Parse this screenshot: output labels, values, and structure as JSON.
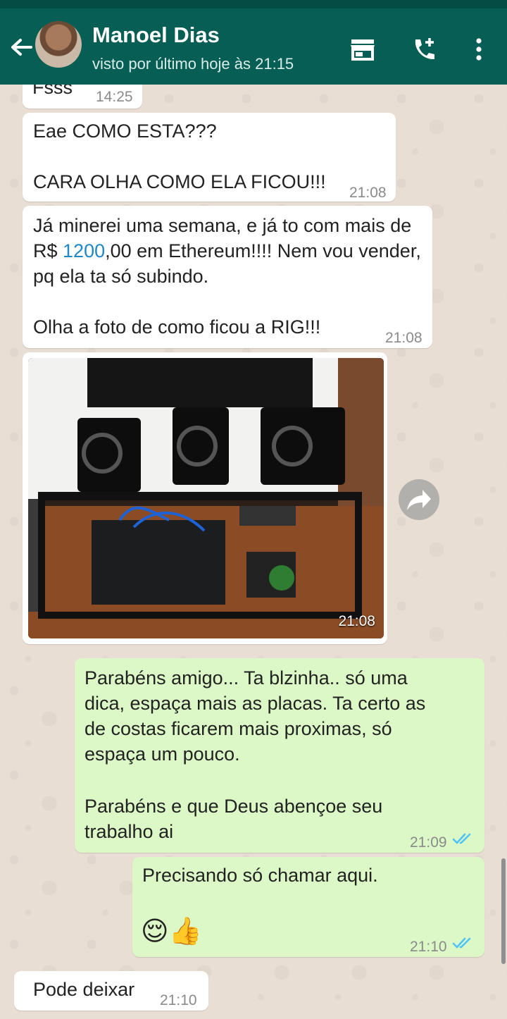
{
  "header": {
    "contact_name": "Manoel Dias",
    "last_seen": "visto por último hoje às 21:15",
    "icons": [
      "back-arrow-icon",
      "storefront-icon",
      "add-call-icon",
      "more-vert-icon"
    ],
    "colors": {
      "bar": "#075e54",
      "status_bar": "#054d44"
    }
  },
  "messages": [
    {
      "text": "Fsss",
      "time": "14:25"
    },
    {
      "text_line1": "Eae COMO ESTA???",
      "text_line2": "CARA OLHA COMO ELA FICOU!!!",
      "time": "21:08"
    },
    {
      "pre": "Já minerei uma semana, e já to com mais de R$ ",
      "link": "1200",
      "post": ",00 em Ethereum!!!! Nem vou vender, pq ela ta só subindo.",
      "line_last": "Olha a foto de como ficou a RIG!!!",
      "time": "21:08"
    },
    {
      "image_caption_time": "21:08"
    },
    {
      "text": "Parabéns amigo... Ta blzinha.. só uma dica, espaça mais as placas. Ta certo as de costas ficarem mais proximas, só espaça um pouco.",
      "text2": "Parabéns e que Deus abençoe seu trabalho ai",
      "time": "21:09"
    },
    {
      "text": "Precisando só chamar aqui.",
      "emoji": "😌👍",
      "time": "21:10"
    },
    {
      "text": "Pode deixar",
      "time": "21:10"
    }
  ],
  "colors": {
    "incoming": "#ffffff",
    "outgoing": "#dcf8c6",
    "read_ticks": "#4fc3f7",
    "link": "#1e88c7"
  }
}
